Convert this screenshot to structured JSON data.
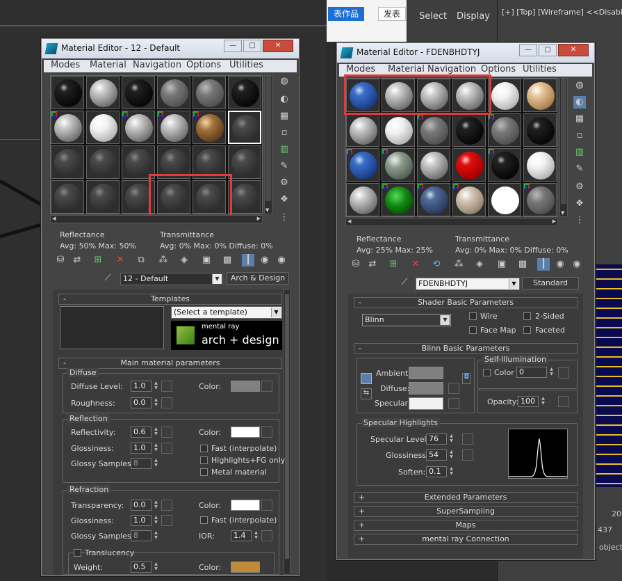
{
  "background": {
    "top_buttons": [
      "表作品",
      "发表"
    ],
    "panel_tabs": [
      "Select",
      "Display"
    ],
    "viewport_label": "[+] [Top] [Wireframe] <<Disable",
    "bottom_labels": [
      "20",
      "437",
      "objects"
    ]
  },
  "left_editor": {
    "title": "Material Editor - 12 - Default",
    "menus": [
      "Modes",
      "Material",
      "Navigation",
      "Options",
      "Utilities"
    ],
    "reflectance_label": "Reflectance",
    "reflectance_vals": "Avg:  50% Max:  50%",
    "transmittance_label": "Transmittance",
    "transmittance_vals": "Avg:   0% Max:   0%  Diffuse:   0%",
    "material_name": "12 - Default",
    "material_type": "Arch & Design",
    "templates": {
      "header": "Templates",
      "select_placeholder": "(Select a template)",
      "brand_small": "mental ray",
      "brand_big": "arch + design"
    },
    "main": {
      "header": "Main material parameters",
      "diffuse_title": "Diffuse",
      "diffuse_level_label": "Diffuse Level:",
      "diffuse_level": "1.0",
      "roughness_label": "Roughness:",
      "roughness": "0.0",
      "color_label": "Color:",
      "reflection_title": "Reflection",
      "reflectivity_label": "Reflectivity:",
      "reflectivity": "0.6",
      "glossiness_label": "Glossiness:",
      "glossiness": "1.0",
      "glossy_samples_label": "Glossy Samples:",
      "glossy_samples": "8",
      "fast_interpolate": "Fast (interpolate)",
      "highlights_fg": "Highlights+FG only",
      "metal_material": "Metal material",
      "refraction_title": "Refraction",
      "transparency_label": "Transparency:",
      "transparency": "0.0",
      "r_glossiness": "1.0",
      "r_glossy_samples": "8",
      "ior_label": "IOR:",
      "ior": "1.4",
      "translucency_label": "Translucency",
      "weight_label": "Weight:",
      "weight": "0.5"
    }
  },
  "right_editor": {
    "title": "Material Editor - FDENBHDTYJ",
    "menus": [
      "Modes",
      "Material",
      "Navigation",
      "Options",
      "Utilities"
    ],
    "reflectance_label": "Reflectance",
    "reflectance_vals": "Avg:  25% Max:  25%",
    "transmittance_label": "Transmittance",
    "transmittance_vals": "Avg:   0% Max:   0%  Diffuse:   0%",
    "material_name": "FDENBHDTYJ",
    "material_type": "Standard",
    "shader": {
      "header": "Shader Basic Parameters",
      "shader_value": "Blinn",
      "wire": "Wire",
      "two_sided": "2-Sided",
      "face_map": "Face Map",
      "faceted": "Faceted"
    },
    "blinn": {
      "header": "Blinn Basic Parameters",
      "ambient_label": "Ambient:",
      "diffuse_label": "Diffuse:",
      "specular_label": "Specular:",
      "self_illum_title": "Self-Illumination",
      "color_label": "Color",
      "color_value": "0",
      "opacity_label": "Opacity:",
      "opacity": "100",
      "spec_title": "Specular Highlights",
      "spec_level_label": "Specular Level:",
      "spec_level": "76",
      "glossiness_label": "Glossiness:",
      "glossiness": "54",
      "soften_label": "Soften:",
      "soften": "0.1"
    },
    "collapsed": [
      "Extended Parameters",
      "SuperSampling",
      "Maps",
      "mental ray Connection"
    ]
  },
  "colors": {
    "highlight_box": "#e23b3b",
    "panel_bg": "#444444",
    "title_bar": "#dde4ee"
  }
}
